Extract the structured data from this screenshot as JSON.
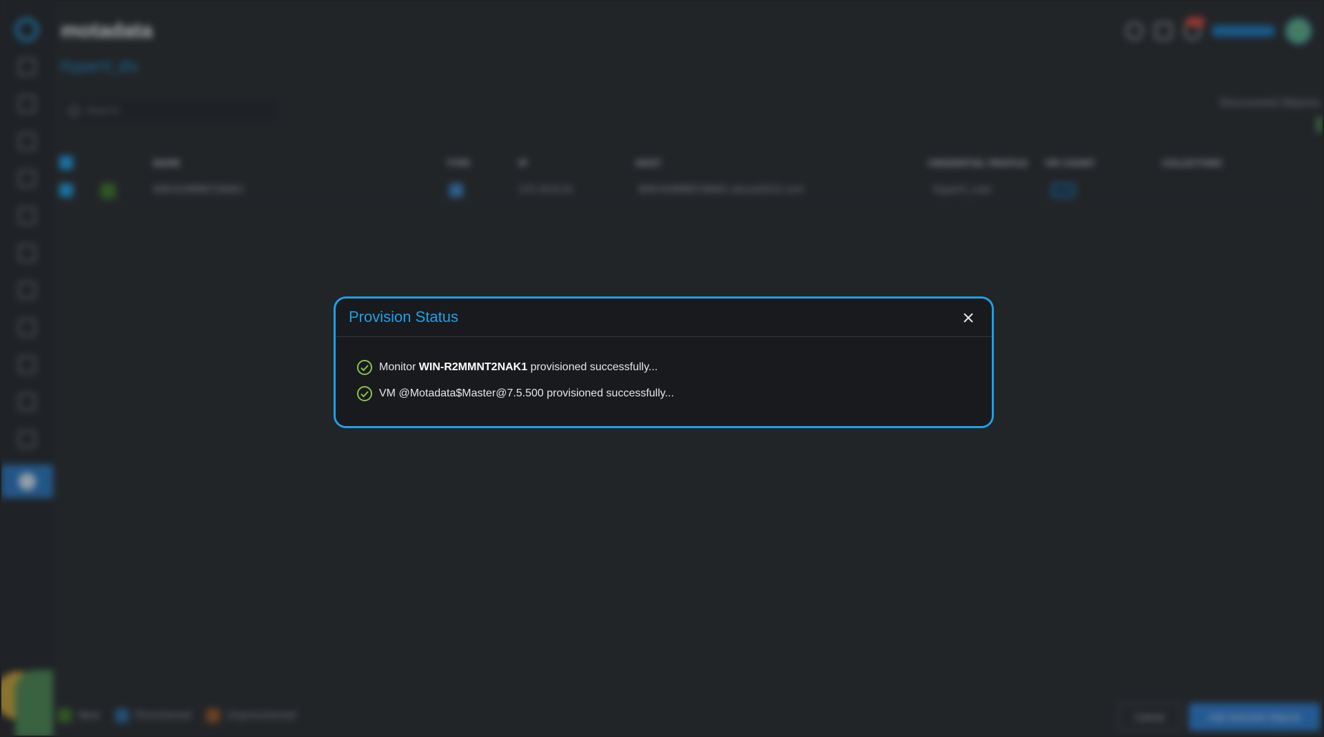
{
  "app": {
    "brand": "motadata",
    "breadcrumb": "HyperV_dis"
  },
  "search": {
    "placeholder": "Search"
  },
  "discovered_label": "Discovered Objects",
  "table": {
    "headers": [
      "NAME",
      "TYPE",
      "IP",
      "HOST",
      "CREDENTIAL PROFILE",
      "VM COUNT",
      "COLLECTORS"
    ],
    "rows": [
      {
        "name": "WIN-R2MMNT2NAK1",
        "ip": "172.16.8.10",
        "host": "WIN-R2MMNT2NAK1.devsd2012.com",
        "credential": "HyperV_cred"
      }
    ]
  },
  "legend": {
    "new": "New",
    "provisioned": "Provisioned",
    "unprovisioned": "Unprovisioned"
  },
  "footer": {
    "cancel": "Cancel",
    "add": "Add Selected Objects"
  },
  "modal": {
    "title": "Provision Status",
    "messages": [
      {
        "prefix": "Monitor ",
        "bold": "WIN-R2MMNT2NAK1",
        "suffix": " provisioned successfully..."
      },
      {
        "prefix": "VM @Motadata$Master@7.5.500 provisioned successfully...",
        "bold": "",
        "suffix": ""
      }
    ]
  },
  "colors": {
    "accent": "#1da1e8",
    "success": "#8bc34a",
    "modal_bg": "#191a1d"
  }
}
